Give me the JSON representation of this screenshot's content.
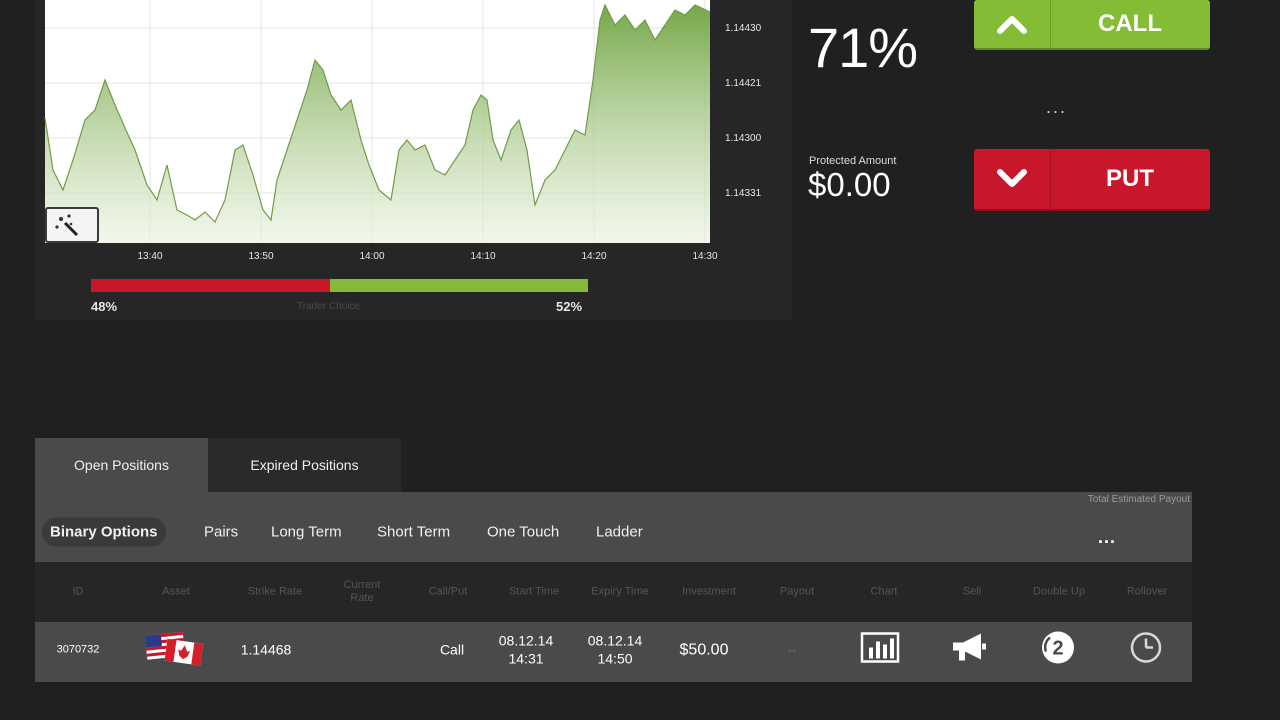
{
  "chart": {
    "y_ticks": [
      "1.14430",
      "1.14421",
      "1.14300",
      "1.14331"
    ],
    "x_ticks": [
      "13:40",
      "13:50",
      "14:00",
      "14:10",
      "14:20",
      "14:30"
    ],
    "colors": {
      "plot_bg": "#ffffff",
      "area_fill": "#7fae55",
      "line": "#6f9c47"
    },
    "tool_icon": "magic-wand-icon"
  },
  "sentiment": {
    "left_pct": "48%",
    "right_pct": "52%",
    "left_value": 0.48,
    "right_value": 0.52,
    "label": "Trader Choice",
    "colors": {
      "put": "#c8172b",
      "call": "#86b83b"
    }
  },
  "trade": {
    "payout_pct": "71%",
    "protected_label": "Protected Amount",
    "protected_value": "$0.00",
    "call_label": "CALL",
    "put_label": "PUT",
    "dots": "...",
    "call_icon": "chevron-up-icon",
    "put_icon": "chevron-down-icon"
  },
  "positions": {
    "tabs": [
      "Open Positions",
      "Expired Positions"
    ],
    "subtabs": [
      "Binary Options",
      "Pairs",
      "Long Term",
      "Short Term",
      "One Touch",
      "Ladder"
    ],
    "payout_label": "Total Estimated Payout",
    "payout_dots": "...",
    "columns": [
      "ID",
      "Asset",
      "Strike Rate",
      "Current Rate",
      "Call/Put",
      "Start Time",
      "Expiry Time",
      "Investment",
      "Payout",
      "Chart",
      "Sell",
      "Double Up",
      "Rollover"
    ],
    "row": {
      "id": "3070732",
      "asset_icon": "usd-cad-flags-icon",
      "strike_rate": "1.14468",
      "current_rate": "",
      "call_put": "Call",
      "start_date": "08.12.14",
      "start_time": "14:31",
      "expiry_date": "08.12.14",
      "expiry_time": "14:50",
      "investment": "$50.00",
      "payout": "--",
      "icons": [
        "bar-chart-icon",
        "megaphone-icon",
        "double-up-icon",
        "clock-icon"
      ]
    }
  }
}
